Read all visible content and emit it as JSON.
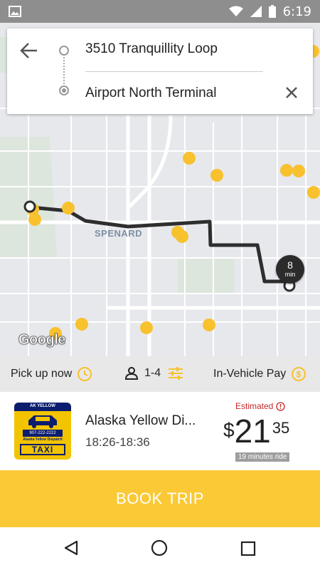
{
  "status_bar": {
    "time": "6:19",
    "icons": [
      "image-icon",
      "wifi-icon",
      "signal-icon",
      "battery-icon"
    ]
  },
  "search": {
    "origin": "3510 Tranquillity Loop",
    "destination": "Airport North Terminal"
  },
  "map": {
    "area_label": "SPENARD",
    "eta_value": "8",
    "eta_unit": "min",
    "attribution": "Google"
  },
  "options": {
    "pickup": "Pick up now",
    "passengers": "1-4",
    "payment": "In-Vehicle Pay"
  },
  "result": {
    "company": "Alaska Yellow Di...",
    "time_range": "18:26-18:36",
    "estimated_label": "Estimated",
    "price_currency": "$",
    "price_whole": "21",
    "price_cents": "35",
    "ride_duration": "19 minutes ride",
    "logo": {
      "top_text": "AK YELLOW",
      "phone": "907-222-2222",
      "name": "Alaska Yellow Dispatch",
      "taxi": "TAXI"
    }
  },
  "actions": {
    "book_label": "BOOK TRIP"
  },
  "colors": {
    "accent": "#fbc936",
    "route": "#2e2e2e",
    "taxi_dot": "#f8c12e",
    "estimated": "#c62828"
  }
}
